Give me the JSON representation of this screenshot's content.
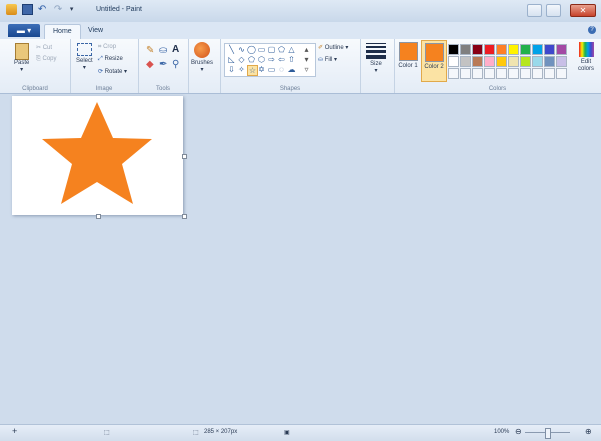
{
  "window": {
    "title": "Untitled - Paint"
  },
  "tabs": {
    "file": "",
    "home": "Home",
    "view": "View"
  },
  "ribbon": {
    "clipboard": {
      "label": "Clipboard",
      "paste": "Paste",
      "cut": "Cut",
      "copy": "Copy"
    },
    "image": {
      "label": "Image",
      "select": "Select",
      "crop": "Crop",
      "resize": "Resize",
      "rotate": "Rotate"
    },
    "tools": {
      "label": "Tools"
    },
    "brushes": {
      "label": "Brushes"
    },
    "shapes": {
      "label": "Shapes",
      "outline": "Outline",
      "fill": "Fill"
    },
    "size": {
      "label": "Size"
    },
    "colors": {
      "label": "Colors",
      "color1": "Color 1",
      "color2": "Color 2",
      "edit": "Edit colors",
      "color1_value": "#f5821f",
      "color2_value": "#f5821f",
      "palette_row1": [
        "#000000",
        "#7f7f7f",
        "#880015",
        "#ed1c24",
        "#ff7f27",
        "#fff200",
        "#22b14c",
        "#00a2e8",
        "#3f48cc",
        "#a349a4"
      ],
      "palette_row2": [
        "#ffffff",
        "#c3c3c3",
        "#b97a57",
        "#ffaec9",
        "#ffc90e",
        "#efe4b0",
        "#b5e61d",
        "#99d9ea",
        "#7092be",
        "#c8bfe7"
      ]
    }
  },
  "canvas": {
    "shape": "star",
    "star_color": "#f5821f"
  },
  "status": {
    "size": "285 × 207px",
    "zoom": "100%"
  }
}
